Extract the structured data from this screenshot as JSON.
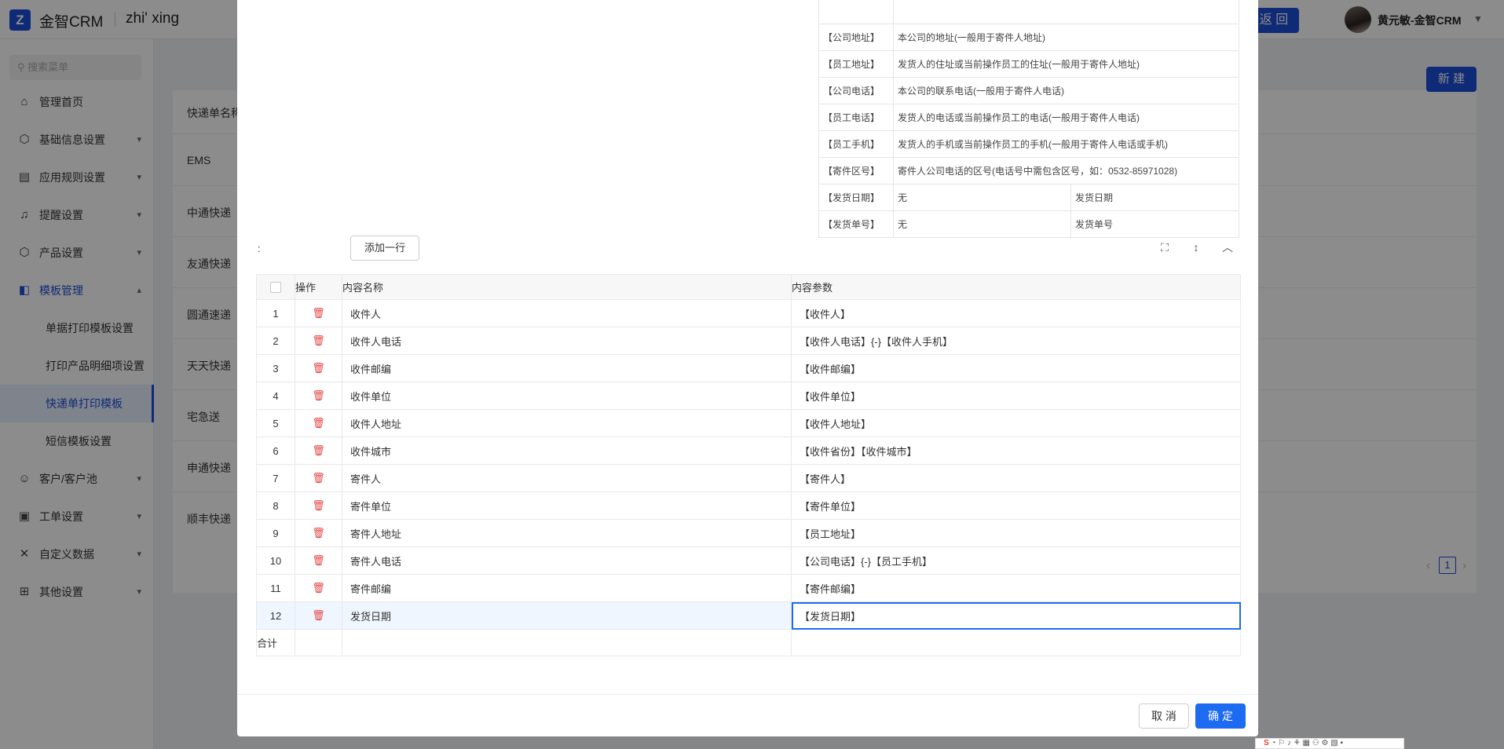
{
  "app": {
    "logo": "Z",
    "title": "金智CRM",
    "subtitle": "zhi' xing",
    "back_label": "返 回",
    "user_name": "黄元敏-金智CRM"
  },
  "sidebar": {
    "search_placeholder": "搜索菜单",
    "items": [
      {
        "label": "管理首页",
        "icon": "home-icon"
      },
      {
        "label": "基础信息设置",
        "icon": "cube-icon"
      },
      {
        "label": "应用规则设置",
        "icon": "document-icon"
      },
      {
        "label": "提醒设置",
        "icon": "bell-icon"
      },
      {
        "label": "产品设置",
        "icon": "cube-icon"
      },
      {
        "label": "模板管理",
        "icon": "template-icon"
      },
      {
        "label": "客户/客户池",
        "icon": "users-icon"
      },
      {
        "label": "工单设置",
        "icon": "ticket-icon"
      },
      {
        "label": "自定义数据",
        "icon": "tools-icon"
      },
      {
        "label": "其他设置",
        "icon": "grid-icon"
      }
    ],
    "sub_items": [
      "单据打印模板设置",
      "打印产品明细项设置",
      "快递单打印模板",
      "短信模板设置"
    ]
  },
  "background": {
    "new_label": "新 建",
    "column_header": "快递单名称",
    "rows": [
      "EMS",
      "中通快递",
      "友通快递",
      "圆通速递",
      "天天快递",
      "宅急送",
      "申通快递",
      "顺丰快递"
    ],
    "page": "1"
  },
  "reference": [
    {
      "key": "【公司地址】",
      "desc": "本公司的地址(一般用于寄件人地址)"
    },
    {
      "key": "【员工地址】",
      "desc": "发货人的住址或当前操作员工的住址(一般用于寄件人地址)"
    },
    {
      "key": "【公司电话】",
      "desc": "本公司的联系电话(一般用于寄件人电话)"
    },
    {
      "key": "【员工电话】",
      "desc": "发货人的电话或当前操作员工的电话(一般用于寄件人电话)"
    },
    {
      "key": "【员工手机】",
      "desc": "发货人的手机或当前操作员工的手机(一般用于寄件人电话或手机)"
    },
    {
      "key": "【寄件区号】",
      "desc": "寄件人公司电话的区号(电话号中需包含区号，如：0532-85971028)"
    },
    {
      "key": "【发货日期】",
      "desc": "无",
      "extra": "发货日期"
    },
    {
      "key": "【发货单号】",
      "desc": "无",
      "extra": "发货单号"
    }
  ],
  "grid": {
    "label": ":",
    "add_row_label": "添加一行",
    "headers": {
      "op": "操作",
      "name": "内容名称",
      "param": "内容参数"
    },
    "total_label": "合计",
    "rows": [
      {
        "no": "1",
        "name": "收件人",
        "param": "【收件人】"
      },
      {
        "no": "2",
        "name": "收件人电话",
        "param": "【收件人电话】{-}【收件人手机】"
      },
      {
        "no": "3",
        "name": "收件邮编",
        "param": "【收件邮编】"
      },
      {
        "no": "4",
        "name": "收件单位",
        "param": "【收件单位】"
      },
      {
        "no": "5",
        "name": "收件人地址",
        "param": "【收件人地址】"
      },
      {
        "no": "6",
        "name": "收件城市",
        "param": "【收件省份】【收件城市】"
      },
      {
        "no": "7",
        "name": "寄件人",
        "param": "【寄件人】"
      },
      {
        "no": "8",
        "name": "寄件单位",
        "param": "【寄件单位】"
      },
      {
        "no": "9",
        "name": "寄件人地址",
        "param": "【员工地址】"
      },
      {
        "no": "10",
        "name": "寄件人电话",
        "param": "【公司电话】{-}【员工手机】"
      },
      {
        "no": "11",
        "name": "寄件邮编",
        "param": "【寄件邮编】"
      },
      {
        "no": "12",
        "name": "发货日期",
        "param": "【发货日期】"
      }
    ]
  },
  "footer": {
    "cancel_label": "取 消",
    "ok_label": "确 定"
  },
  "colors": {
    "primary": "#1d4ed8",
    "danger": "#e54545",
    "mask": "rgba(0,0,0,0.45)"
  }
}
